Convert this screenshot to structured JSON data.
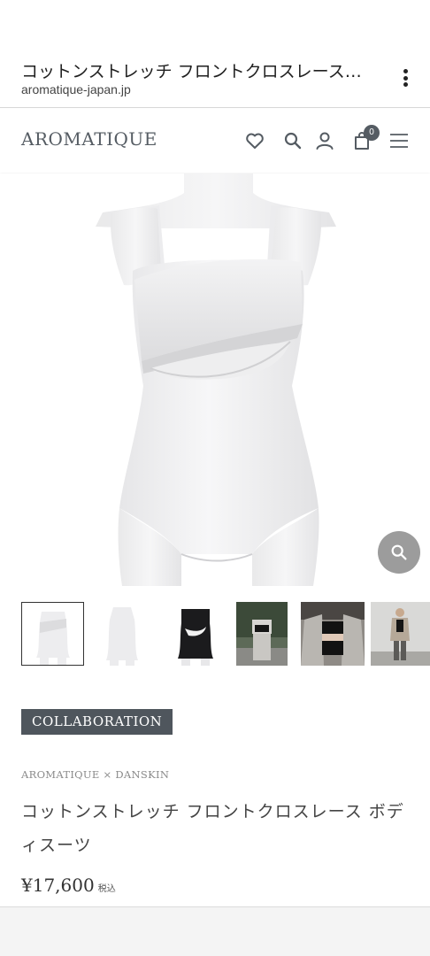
{
  "browser": {
    "page_title": "コットンストレッチ フロントクロスレースボ...",
    "url": "aromatique-japan.jp"
  },
  "header": {
    "logo": "AROMATIQUE",
    "cart_count": "0",
    "icons": [
      "heart-icon",
      "search-icon",
      "account-icon",
      "cart-icon",
      "menu-icon"
    ]
  },
  "gallery": {
    "thumbnail_count": 6,
    "selected_index": 0
  },
  "product": {
    "tag": "COLLABORATION",
    "brand": "AROMATIQUE × DANSKIN",
    "name": "コットンストレッチ フロントクロスレース ボディスーツ",
    "price": "¥17,600",
    "tax_label": "税込"
  },
  "colors": {
    "accent": "#4f565d",
    "logo": "#555c63",
    "zoom_button": "#9c9c9c"
  }
}
